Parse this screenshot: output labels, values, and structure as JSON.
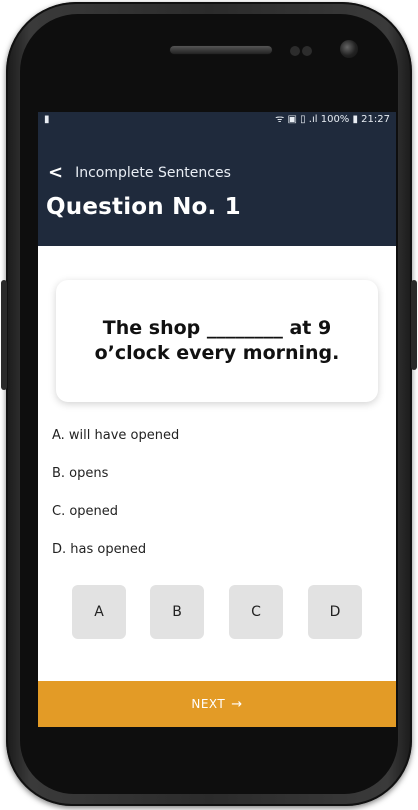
{
  "status_bar": {
    "left_icon": "notification-icon",
    "right_text": "100% ▮ 21:27",
    "signal_text": "ᯤ ▣ ▯ .ıl"
  },
  "header": {
    "back_icon": "chevron-left-icon",
    "subtitle": "Incomplete Sentences",
    "title": "Question No. 1"
  },
  "question": {
    "text": "The shop ________ at 9 o’clock every morning."
  },
  "options": [
    {
      "label": "A. will have opened"
    },
    {
      "label": "B. opens"
    },
    {
      "label": "C. opened"
    },
    {
      "label": "D. has opened"
    }
  ],
  "answer_buttons": [
    "A",
    "B",
    "C",
    "D"
  ],
  "next_button": {
    "label": "NEXT",
    "arrow": "→"
  },
  "colors": {
    "header_bg": "#1f2a3c",
    "next_bg": "#e39b26",
    "answer_btn_bg": "#e2e2e2"
  }
}
